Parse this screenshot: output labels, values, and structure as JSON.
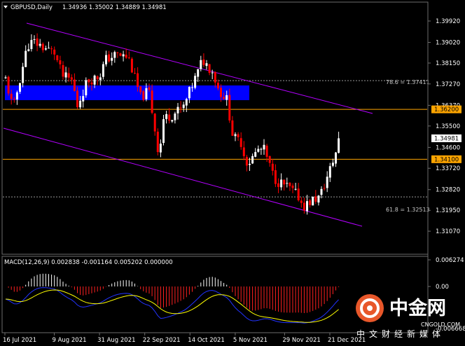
{
  "header": {
    "symbol": "GBPUSD,Daily",
    "ohlc": "1.34936 1.35002 1.34889 1.34981"
  },
  "macd_label": "MACD(12,26,9) 0.002838 -0.001164 0.005202 0.000000",
  "price_axis": [
    "1.39920",
    "1.39020",
    "1.38150",
    "1.37270",
    "1.36370",
    "1.35500",
    "1.34600",
    "1.33720",
    "1.32820",
    "1.31950",
    "1.31070"
  ],
  "macd_axis": {
    "top": "0.006274",
    "mid": "0.00",
    "bottom": "-0.006668"
  },
  "date_axis": [
    "16 Jul 2021",
    "9 Aug 2021",
    "31 Aug 2021",
    "22 Sep 2021",
    "14 Oct 2021",
    "5 Nov 2021",
    "29 Nov 2021",
    "21 Dec 2021"
  ],
  "levels": {
    "level_1": {
      "label": "1.36200",
      "price": 1.362
    },
    "level_2": {
      "label": "1.34100",
      "price": 1.341
    }
  },
  "current_price": "1.34981",
  "fib": {
    "f786": {
      "label": "78.6 = 1.37411",
      "price": 1.37411
    },
    "f618": {
      "label": "61.8 = 1.32513",
      "price": 1.32513
    }
  },
  "zone": {
    "top": 1.3745,
    "bottom": 1.3695,
    "color": "#0000ff"
  },
  "colors": {
    "bull": "#ffffff",
    "bear": "#ff0000",
    "channel": "#b300ff",
    "level": "#ffa500",
    "macd_main": "#2233ff",
    "macd_signal": "#ffff00",
    "hist_pos": "#ffffff",
    "hist_neg": "#ff2020",
    "zone": "#0000ff"
  },
  "watermark": {
    "brand": "中金网",
    "domain": "CNGOLD.COM",
    "slogan": "中文财经新媒体"
  },
  "chart_data": {
    "type": "candlestick",
    "symbol": "GBPUSD",
    "timeframe": "Daily",
    "xlabel": "",
    "ylabel": "",
    "y_range": [
      1.3077,
      1.403
    ],
    "x_ticks": [
      "16 Jul 2021",
      "9 Aug 2021",
      "31 Aug 2021",
      "22 Sep 2021",
      "14 Oct 2021",
      "5 Nov 2021",
      "29 Nov 2021",
      "21 Dec 2021"
    ],
    "close_path": [
      [
        "16 Jul 2021",
        1.376
      ],
      [
        "20 Jul 2021",
        1.362
      ],
      [
        "27 Jul 2021",
        1.389
      ],
      [
        "30 Jul 2021",
        1.3905
      ],
      [
        "4 Aug 2021",
        1.388
      ],
      [
        "9 Aug 2021",
        1.386
      ],
      [
        "13 Aug 2021",
        1.376
      ],
      [
        "18 Aug 2021",
        1.374
      ],
      [
        "20 Aug 2021",
        1.363
      ],
      [
        "25 Aug 2021",
        1.374
      ],
      [
        "31 Aug 2021",
        1.376
      ],
      [
        "3 Sep 2021",
        1.383
      ],
      [
        "8 Sep 2021",
        1.385
      ],
      [
        "14 Sep 2021",
        1.384
      ],
      [
        "20 Sep 2021",
        1.367
      ],
      [
        "24 Sep 2021",
        1.37
      ],
      [
        "29 Sep 2021",
        1.342
      ],
      [
        "1 Oct 2021",
        1.358
      ],
      [
        "6 Oct 2021",
        1.36
      ],
      [
        "11 Oct 2021",
        1.363
      ],
      [
        "14 Oct 2021",
        1.37
      ],
      [
        "18 Oct 2021",
        1.378
      ],
      [
        "20 Oct 2021",
        1.383
      ],
      [
        "25 Oct 2021",
        1.378
      ],
      [
        "28 Oct 2021",
        1.37
      ],
      [
        "1 Nov 2021",
        1.366
      ],
      [
        "4 Nov 2021",
        1.35
      ],
      [
        "8 Nov 2021",
        1.348
      ],
      [
        "10 Nov 2021",
        1.34
      ],
      [
        "12 Nov 2021",
        1.34
      ],
      [
        "16 Nov 2021",
        1.345
      ],
      [
        "19 Nov 2021",
        1.345
      ],
      [
        "23 Nov 2021",
        1.335
      ],
      [
        "25 Nov 2021",
        1.332
      ],
      [
        "29 Nov 2021",
        1.33
      ],
      [
        "1 Dec 2021",
        1.329
      ],
      [
        "6 Dec 2021",
        1.325
      ],
      [
        "8 Dec 2021",
        1.321
      ],
      [
        "13 Dec 2021",
        1.324
      ],
      [
        "16 Dec 2021",
        1.325
      ],
      [
        "20 Dec 2021",
        1.334
      ],
      [
        "22 Dec 2021",
        1.339
      ],
      [
        "24 Dec 2021",
        1.344
      ],
      [
        "28 Dec 2021",
        1.347
      ],
      [
        "29 Dec 2021",
        1.3498
      ]
    ],
    "channel": {
      "upper": [
        [
          "16 Jul 2021",
          1.398
        ],
        [
          "31 Dec 2021",
          1.3665
        ]
      ],
      "lower": [
        [
          "16 Jul 2021",
          1.36
        ],
        [
          "31 Dec 2021",
          1.3175
        ]
      ]
    },
    "horizontal_levels": [
      1.362,
      1.341
    ],
    "fibonacci": [
      {
        "level": "78.6",
        "price": 1.37411
      },
      {
        "level": "61.8",
        "price": 1.32513
      }
    ],
    "macd": {
      "params": "12,26,9",
      "main": 0.002838,
      "signal": -0.001164,
      "histogram": 0.005202,
      "y_range": [
        -0.006668,
        0.006274
      ]
    }
  }
}
